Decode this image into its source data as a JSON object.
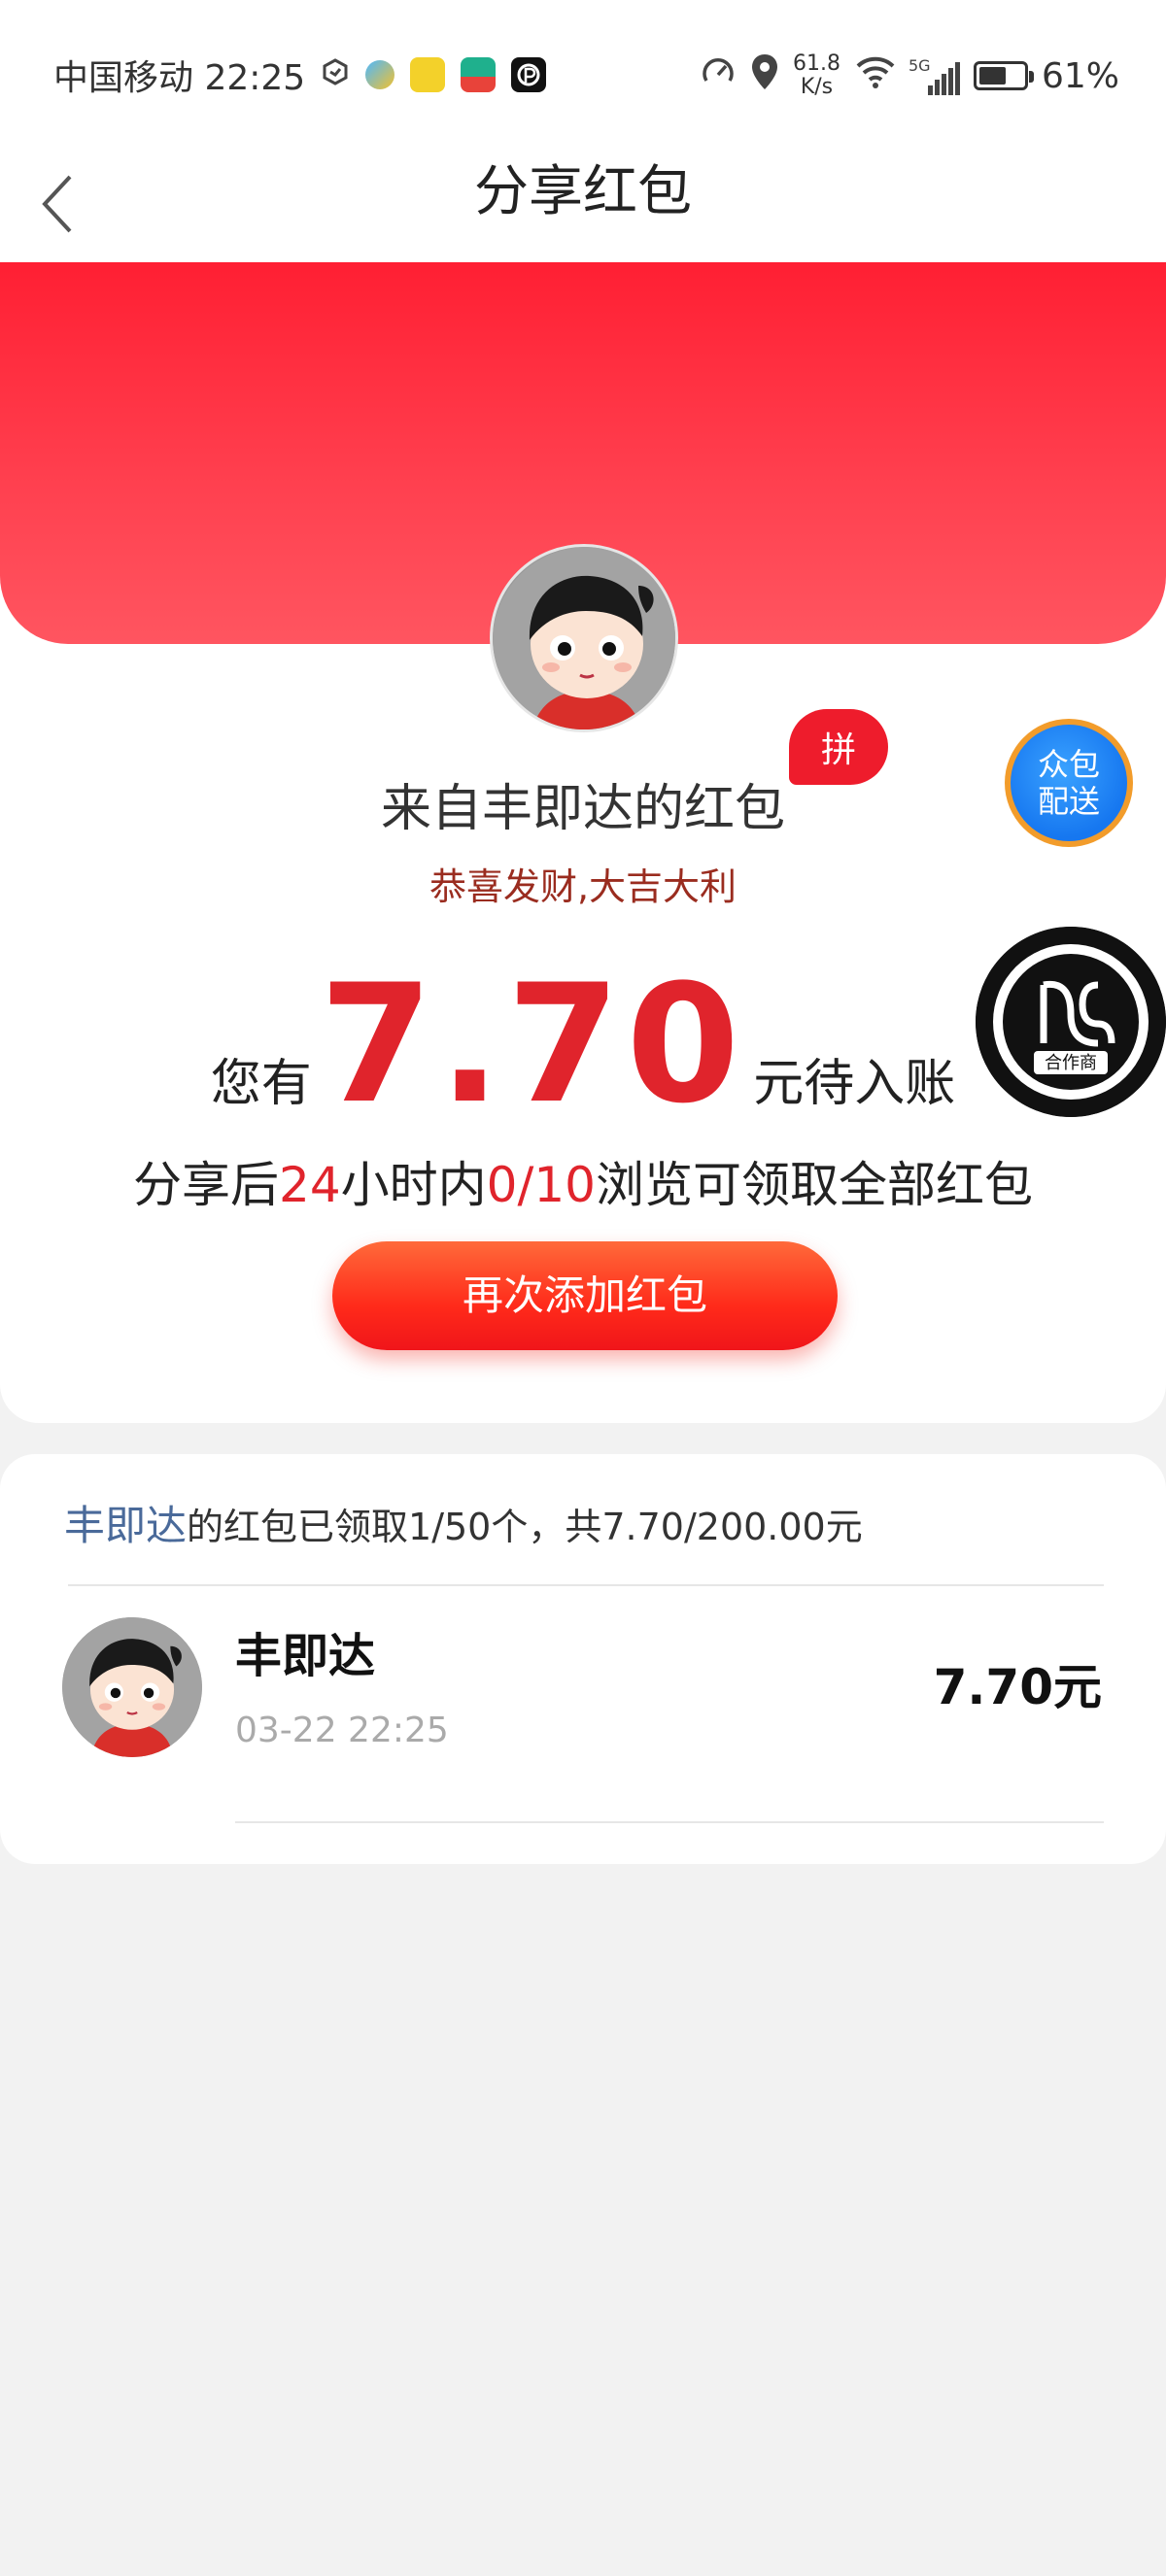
{
  "status_bar": {
    "carrier_time": "中国移动 22:25",
    "net_speed_value": "61.8",
    "net_speed_unit": "K/s",
    "signal_label": "5G",
    "battery": "61%",
    "battery_level": 0.61
  },
  "nav": {
    "title": "分享红包",
    "back_icon": "chevron-left-icon"
  },
  "red_packet": {
    "from_title": "来自丰即达的红包",
    "pin_badge": "拼",
    "greeting": "恭喜发财,大吉大利",
    "amount_prefix": "您有",
    "amount": "7.70",
    "amount_suffix": "元待入账",
    "share_rule": {
      "part1": "分享后",
      "hours": "24",
      "part2": "小时内",
      "progress": "0/10",
      "part3": "浏览可领取全部红包"
    },
    "add_button": "再次添加红包",
    "colors": {
      "header_red": "#ff2a38",
      "amount_red": "#e0242c",
      "greeting_brown": "#9a2c1f"
    }
  },
  "floating": {
    "zhongbao_line1": "众包",
    "zhongbao_line2": "配送",
    "partner_label": "合作商"
  },
  "records": {
    "sender": "丰即达",
    "summary": "的红包已领取1/50个，共7.70/200.00元",
    "items": [
      {
        "name": "丰即达",
        "time": "03-22 22:25",
        "amount": "7.70元"
      }
    ]
  }
}
